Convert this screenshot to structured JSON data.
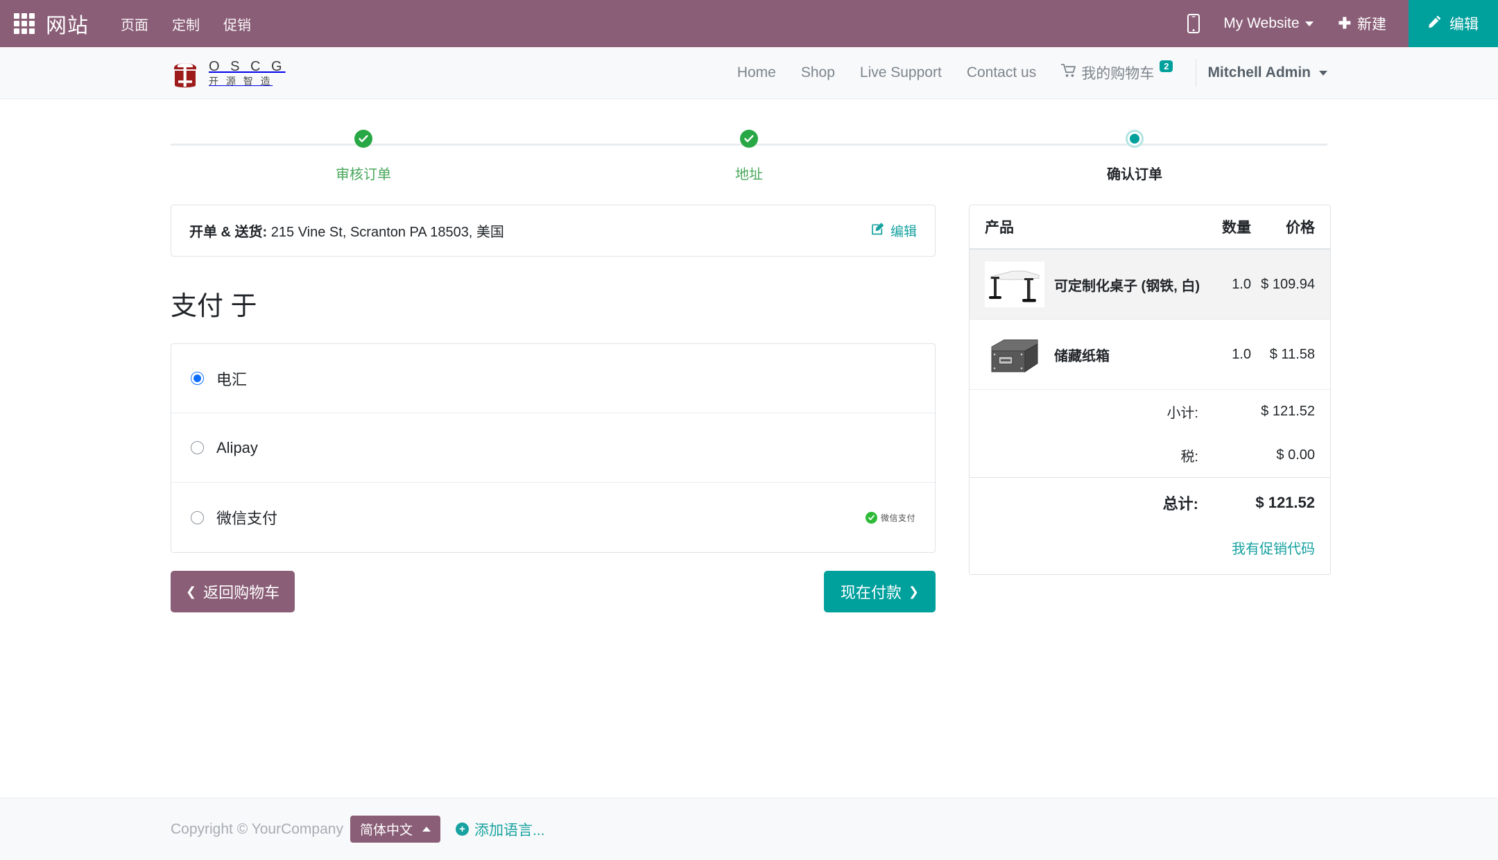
{
  "odoo_bar": {
    "apps_icon": "apps-grid-icon",
    "brand": "网站",
    "menus": [
      {
        "label": "页面"
      },
      {
        "label": "定制"
      },
      {
        "label": "促销"
      }
    ],
    "mobile_icon": "mobile-preview-icon",
    "website_selector": "My Website",
    "new_label": "新建",
    "new_icon": "plus-icon",
    "edit_label": "编辑",
    "edit_icon": "pencil-icon",
    "bar_color": "#8a5e77",
    "edit_color": "#00a09d"
  },
  "site_header": {
    "logo_en": "O S C G",
    "logo_cn": "开 源 智 造",
    "nav": [
      {
        "label": "Home"
      },
      {
        "label": "Shop"
      },
      {
        "label": "Live Support"
      },
      {
        "label": "Contact us"
      }
    ],
    "cart": {
      "label": "我的购物车",
      "badge": "2",
      "icon": "shopping-cart-icon"
    },
    "user": {
      "name": "Mitchell Admin"
    }
  },
  "wizard": {
    "steps": [
      {
        "label": "审核订单",
        "state": "done"
      },
      {
        "label": "地址",
        "state": "done"
      },
      {
        "label": "确认订单",
        "state": "current"
      }
    ]
  },
  "address": {
    "label": "开单 & 送货:",
    "value": "215 Vine St, Scranton PA 18503, 美国",
    "edit_label": "编辑",
    "edit_icon": "edit-pencil-icon"
  },
  "payment": {
    "title": "支付 于",
    "options": [
      {
        "label": "电汇",
        "selected": true,
        "logo": null
      },
      {
        "label": "Alipay",
        "selected": false,
        "logo": null
      },
      {
        "label": "微信支付",
        "selected": false,
        "logo": "微信支付"
      }
    ]
  },
  "actions": {
    "back_label": "返回购物车",
    "back_icon": "chevron-left-icon",
    "pay_label": "现在付款",
    "pay_icon": "chevron-right-icon"
  },
  "summary": {
    "headers": {
      "product": "产品",
      "qty": "数量",
      "price": "价格"
    },
    "items": [
      {
        "name": "可定制化桌子 (钢铁, 白)",
        "qty": "1.0",
        "price": "$ 109.94",
        "image": "desk-image"
      },
      {
        "name": "储藏纸箱",
        "qty": "1.0",
        "price": "$ 11.58",
        "image": "storage-box-image"
      }
    ],
    "subtotal": {
      "label": "小计:",
      "value": "$ 121.52"
    },
    "tax": {
      "label": "税:",
      "value": "$ 0.00"
    },
    "total": {
      "label": "总计:",
      "value": "$ 121.52"
    },
    "promo_link": "我有促销代码"
  },
  "footer": {
    "copyright": "Copyright © YourCompany",
    "language": "简体中文",
    "add_language": "添加语言..."
  }
}
